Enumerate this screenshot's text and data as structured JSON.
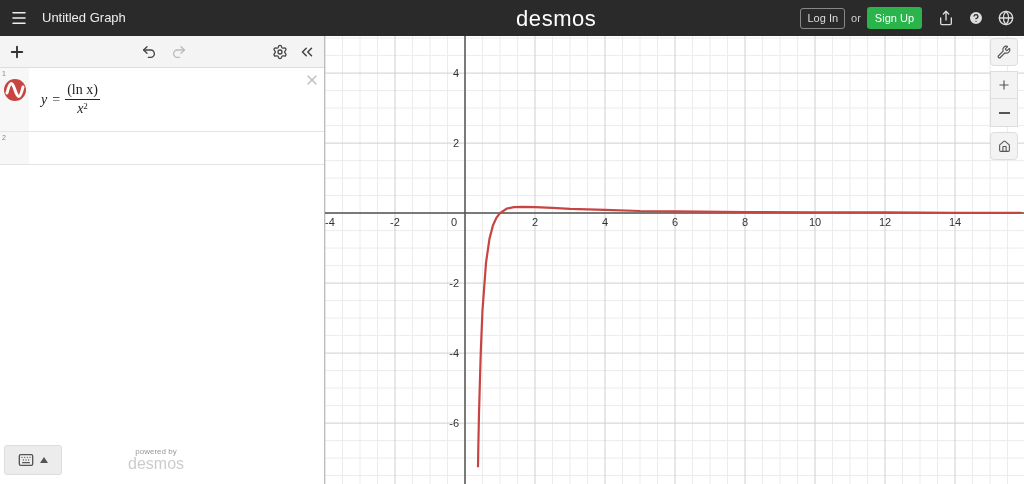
{
  "header": {
    "title": "Untitled Graph",
    "logo": "desmos",
    "login": "Log In",
    "or": "or",
    "signup": "Sign Up"
  },
  "expressions": [
    {
      "number": "1",
      "kind": "fraction",
      "lhs": "y",
      "equals": "=",
      "numerator": "(ln x)",
      "base": "x",
      "exponent": "2",
      "color": "#c74440"
    },
    {
      "number": "2",
      "kind": "empty"
    }
  ],
  "footer": {
    "powered": "powered by",
    "brand": "desmos"
  },
  "graph": {
    "chart_data": {
      "type": "line",
      "grid": true,
      "xlim": [
        -4,
        15.97
      ],
      "ylim": [
        -7.74,
        5.06
      ],
      "xticks": [
        -4,
        -2,
        2,
        4,
        6,
        8,
        10,
        12,
        14
      ],
      "yticks": [
        4,
        2,
        -2,
        -4,
        -6
      ],
      "x": [
        0.37,
        0.38,
        0.4,
        0.45,
        0.5,
        0.6,
        0.7,
        0.8,
        0.9,
        1,
        1.2,
        1.4,
        1.65,
        2,
        2.5,
        3,
        4,
        5,
        6,
        8,
        10,
        12,
        14,
        15.9
      ],
      "series": [
        {
          "color": "#c74440",
          "values": [
            -7.26,
            -6.7,
            -5.73,
            -3.94,
            -2.77,
            -1.42,
            -0.73,
            -0.35,
            -0.13,
            0,
            0.13,
            0.17,
            0.18,
            0.17,
            0.15,
            0.12,
            0.09,
            0.06,
            0.05,
            0.03,
            0.02,
            0.02,
            0.01,
            0.01
          ]
        }
      ]
    },
    "origin_label": "0"
  }
}
